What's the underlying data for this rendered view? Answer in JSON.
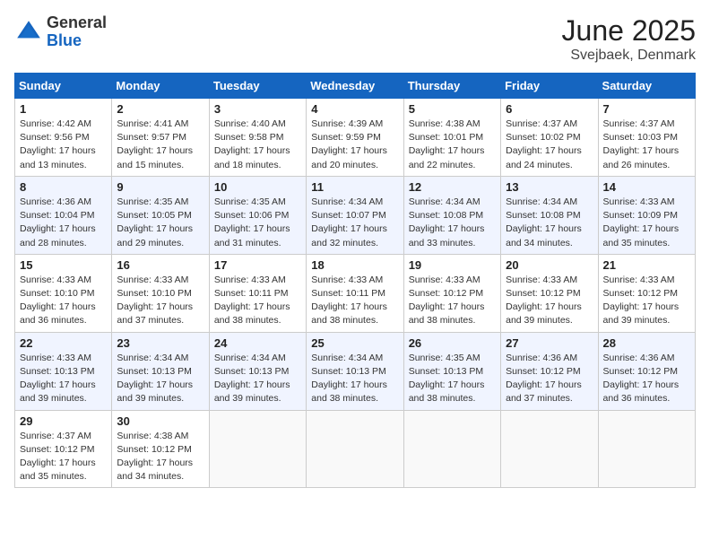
{
  "logo": {
    "general": "General",
    "blue": "Blue"
  },
  "title": "June 2025",
  "location": "Svejbaek, Denmark",
  "columns": [
    "Sunday",
    "Monday",
    "Tuesday",
    "Wednesday",
    "Thursday",
    "Friday",
    "Saturday"
  ],
  "weeks": [
    [
      {
        "day": "1",
        "info": "Sunrise: 4:42 AM\nSunset: 9:56 PM\nDaylight: 17 hours\nand 13 minutes."
      },
      {
        "day": "2",
        "info": "Sunrise: 4:41 AM\nSunset: 9:57 PM\nDaylight: 17 hours\nand 15 minutes."
      },
      {
        "day": "3",
        "info": "Sunrise: 4:40 AM\nSunset: 9:58 PM\nDaylight: 17 hours\nand 18 minutes."
      },
      {
        "day": "4",
        "info": "Sunrise: 4:39 AM\nSunset: 9:59 PM\nDaylight: 17 hours\nand 20 minutes."
      },
      {
        "day": "5",
        "info": "Sunrise: 4:38 AM\nSunset: 10:01 PM\nDaylight: 17 hours\nand 22 minutes."
      },
      {
        "day": "6",
        "info": "Sunrise: 4:37 AM\nSunset: 10:02 PM\nDaylight: 17 hours\nand 24 minutes."
      },
      {
        "day": "7",
        "info": "Sunrise: 4:37 AM\nSunset: 10:03 PM\nDaylight: 17 hours\nand 26 minutes."
      }
    ],
    [
      {
        "day": "8",
        "info": "Sunrise: 4:36 AM\nSunset: 10:04 PM\nDaylight: 17 hours\nand 28 minutes."
      },
      {
        "day": "9",
        "info": "Sunrise: 4:35 AM\nSunset: 10:05 PM\nDaylight: 17 hours\nand 29 minutes."
      },
      {
        "day": "10",
        "info": "Sunrise: 4:35 AM\nSunset: 10:06 PM\nDaylight: 17 hours\nand 31 minutes."
      },
      {
        "day": "11",
        "info": "Sunrise: 4:34 AM\nSunset: 10:07 PM\nDaylight: 17 hours\nand 32 minutes."
      },
      {
        "day": "12",
        "info": "Sunrise: 4:34 AM\nSunset: 10:08 PM\nDaylight: 17 hours\nand 33 minutes."
      },
      {
        "day": "13",
        "info": "Sunrise: 4:34 AM\nSunset: 10:08 PM\nDaylight: 17 hours\nand 34 minutes."
      },
      {
        "day": "14",
        "info": "Sunrise: 4:33 AM\nSunset: 10:09 PM\nDaylight: 17 hours\nand 35 minutes."
      }
    ],
    [
      {
        "day": "15",
        "info": "Sunrise: 4:33 AM\nSunset: 10:10 PM\nDaylight: 17 hours\nand 36 minutes."
      },
      {
        "day": "16",
        "info": "Sunrise: 4:33 AM\nSunset: 10:10 PM\nDaylight: 17 hours\nand 37 minutes."
      },
      {
        "day": "17",
        "info": "Sunrise: 4:33 AM\nSunset: 10:11 PM\nDaylight: 17 hours\nand 38 minutes."
      },
      {
        "day": "18",
        "info": "Sunrise: 4:33 AM\nSunset: 10:11 PM\nDaylight: 17 hours\nand 38 minutes."
      },
      {
        "day": "19",
        "info": "Sunrise: 4:33 AM\nSunset: 10:12 PM\nDaylight: 17 hours\nand 38 minutes."
      },
      {
        "day": "20",
        "info": "Sunrise: 4:33 AM\nSunset: 10:12 PM\nDaylight: 17 hours\nand 39 minutes."
      },
      {
        "day": "21",
        "info": "Sunrise: 4:33 AM\nSunset: 10:12 PM\nDaylight: 17 hours\nand 39 minutes."
      }
    ],
    [
      {
        "day": "22",
        "info": "Sunrise: 4:33 AM\nSunset: 10:13 PM\nDaylight: 17 hours\nand 39 minutes."
      },
      {
        "day": "23",
        "info": "Sunrise: 4:34 AM\nSunset: 10:13 PM\nDaylight: 17 hours\nand 39 minutes."
      },
      {
        "day": "24",
        "info": "Sunrise: 4:34 AM\nSunset: 10:13 PM\nDaylight: 17 hours\nand 39 minutes."
      },
      {
        "day": "25",
        "info": "Sunrise: 4:34 AM\nSunset: 10:13 PM\nDaylight: 17 hours\nand 38 minutes."
      },
      {
        "day": "26",
        "info": "Sunrise: 4:35 AM\nSunset: 10:13 PM\nDaylight: 17 hours\nand 38 minutes."
      },
      {
        "day": "27",
        "info": "Sunrise: 4:36 AM\nSunset: 10:12 PM\nDaylight: 17 hours\nand 37 minutes."
      },
      {
        "day": "28",
        "info": "Sunrise: 4:36 AM\nSunset: 10:12 PM\nDaylight: 17 hours\nand 36 minutes."
      }
    ],
    [
      {
        "day": "29",
        "info": "Sunrise: 4:37 AM\nSunset: 10:12 PM\nDaylight: 17 hours\nand 35 minutes."
      },
      {
        "day": "30",
        "info": "Sunrise: 4:38 AM\nSunset: 10:12 PM\nDaylight: 17 hours\nand 34 minutes."
      },
      {
        "day": "",
        "info": ""
      },
      {
        "day": "",
        "info": ""
      },
      {
        "day": "",
        "info": ""
      },
      {
        "day": "",
        "info": ""
      },
      {
        "day": "",
        "info": ""
      }
    ]
  ]
}
